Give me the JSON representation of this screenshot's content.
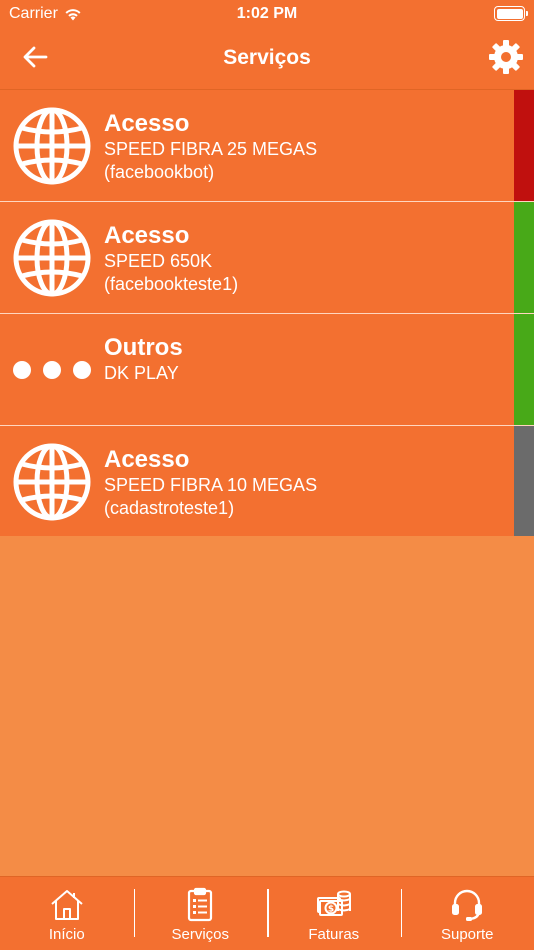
{
  "status_bar": {
    "carrier": "Carrier",
    "time": "1:02 PM"
  },
  "header": {
    "title": "Serviços"
  },
  "services": [
    {
      "icon": "globe-icon",
      "title": "Acesso",
      "plan": "SPEED FIBRA 25 MEGAS",
      "login": "(facebookbot)",
      "status_color": "#c0100e"
    },
    {
      "icon": "globe-icon",
      "title": "Acesso",
      "plan": "SPEED 650K",
      "login": "(facebookteste1)",
      "status_color": "#48a918"
    },
    {
      "icon": "ellipsis-icon",
      "title": "Outros",
      "plan": "DK PLAY",
      "login": "",
      "status_color": "#48a918"
    },
    {
      "icon": "globe-icon",
      "title": "Acesso",
      "plan": "SPEED FIBRA 10 MEGAS",
      "login": "(cadastroteste1)",
      "status_color": "#6b6b6b"
    }
  ],
  "tabs": [
    {
      "icon": "home-icon",
      "label": "Início"
    },
    {
      "icon": "document-list-icon",
      "label": "Serviços"
    },
    {
      "icon": "money-icon",
      "label": "Faturas"
    },
    {
      "icon": "headset-icon",
      "label": "Suporte"
    }
  ],
  "colors": {
    "primary": "#f37030",
    "background": "#f48c46"
  }
}
